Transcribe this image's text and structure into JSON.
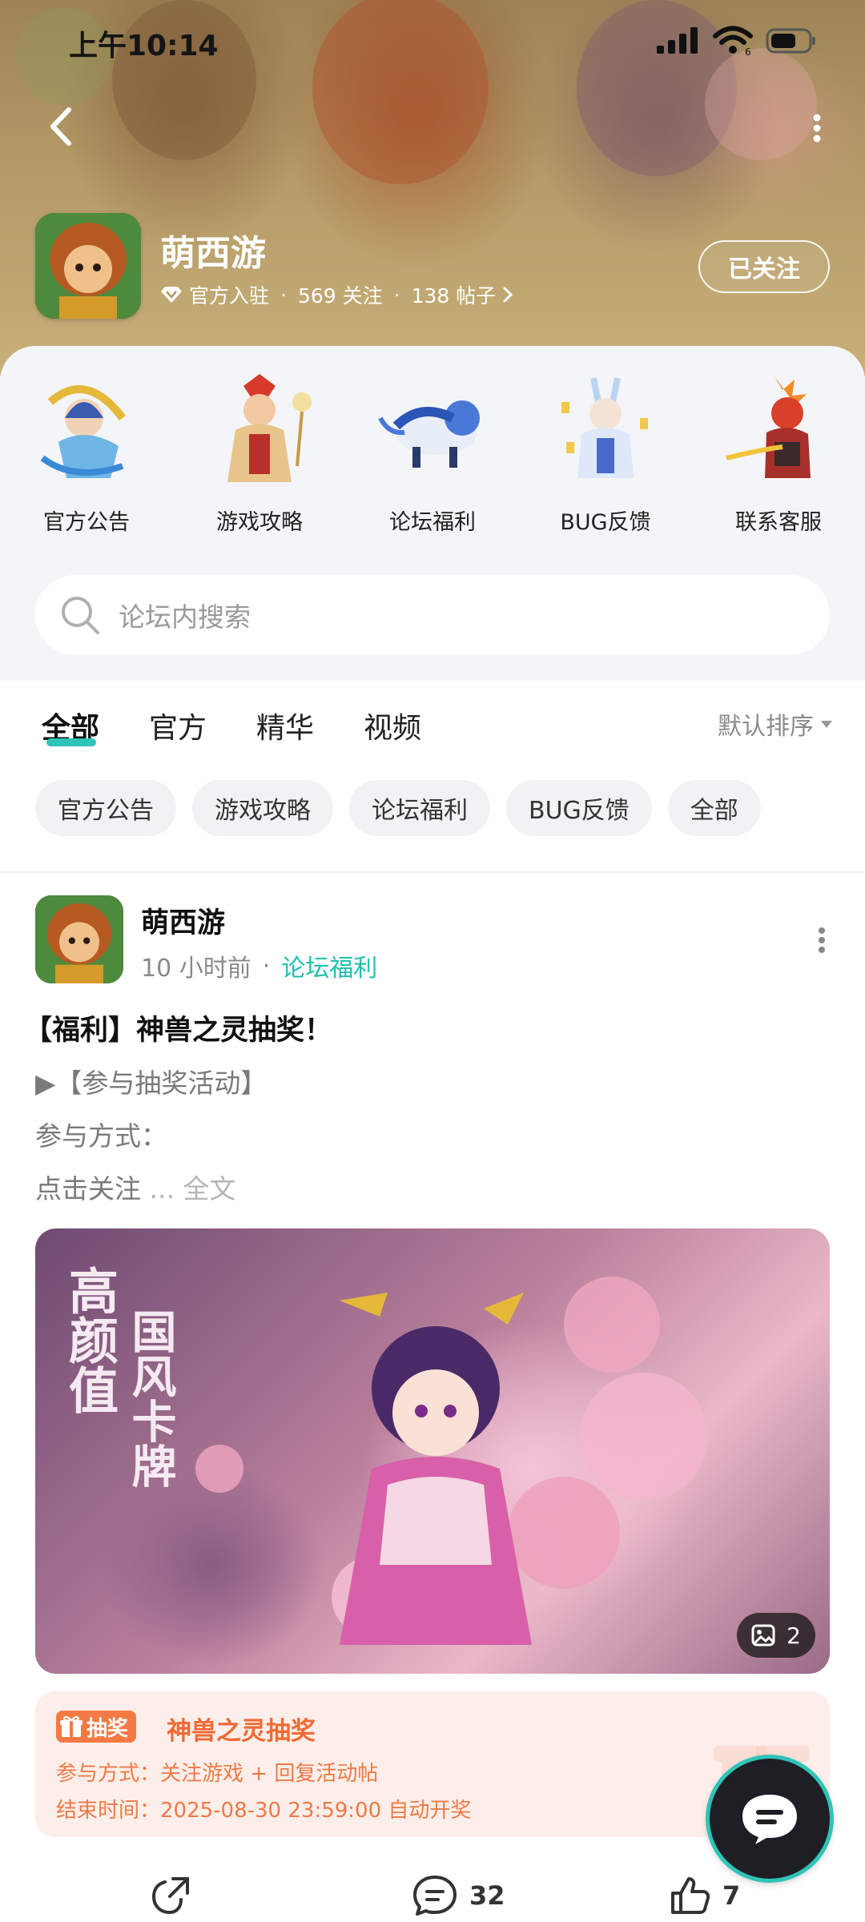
{
  "status_bar": {
    "time": "上午10:14",
    "signal_label": "6"
  },
  "header": {
    "game_name": "萌西游",
    "badge": "官方入驻",
    "followers": "569 关注",
    "posts": "138 帖子",
    "follow_label": "已关注"
  },
  "categories": [
    {
      "label": "官方公告"
    },
    {
      "label": "游戏攻略"
    },
    {
      "label": "论坛福利"
    },
    {
      "label": "BUG反馈"
    },
    {
      "label": "联系客服"
    }
  ],
  "search": {
    "placeholder": "论坛内搜索"
  },
  "tabs": [
    {
      "label": "全部"
    },
    {
      "label": "官方"
    },
    {
      "label": "精华"
    },
    {
      "label": "视频"
    }
  ],
  "sort_label": "默认排序",
  "chips": [
    {
      "label": "官方公告"
    },
    {
      "label": "游戏攻略"
    },
    {
      "label": "论坛福利"
    },
    {
      "label": "BUG反馈"
    },
    {
      "label": "全部"
    }
  ],
  "post": {
    "author": "萌西游",
    "time": "10 小时前",
    "category": "论坛福利",
    "title": "【福利】神兽之灵抽奖！",
    "line1": "▶【参与抽奖活动】",
    "line2": "参与方式：",
    "line3": "点击关注",
    "more_label": "... 全文",
    "image_text_1": "高颜值",
    "image_text_2": "国风卡牌",
    "image_count": "2",
    "lottery": {
      "tag": "抽奖",
      "title": "神兽之灵抽奖",
      "method": "参与方式：关注游戏 + 回复活动帖",
      "end_time": "结束时间：2025-08-30 23:59:00 自动开奖"
    },
    "comments": "32",
    "likes": "7"
  },
  "colors": {
    "accent": "#2ec4b6",
    "lottery_orange": "#f06a35"
  }
}
